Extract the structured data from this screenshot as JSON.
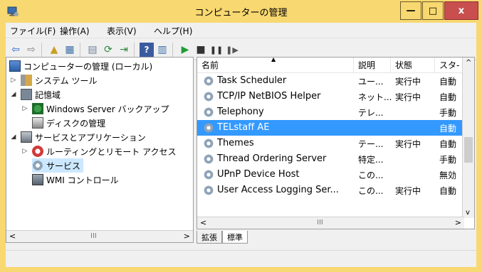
{
  "window": {
    "title": "コンピューターの管理",
    "min_label": "—",
    "max_label": "□",
    "close_label": "x"
  },
  "menu": [
    "ファイル(F)",
    "操作(A)",
    "表示(V)",
    "ヘルプ(H)"
  ],
  "tree": [
    {
      "label": "コンピューターの管理 (ローカル)",
      "icon": "computer-icon",
      "expander": ""
    },
    {
      "label": "システム ツール",
      "icon": "tools-icon",
      "expander": "▷"
    },
    {
      "label": "記憶域",
      "icon": "storage-icon",
      "expander": "◢"
    },
    {
      "label": "Windows Server バックアップ",
      "icon": "backup-icon",
      "expander": "▷"
    },
    {
      "label": "ディスクの管理",
      "icon": "disk-icon",
      "expander": ""
    },
    {
      "label": "サービスとアプリケーション",
      "icon": "services-apps-icon",
      "expander": "◢"
    },
    {
      "label": "ルーティングとリモート アクセス",
      "icon": "routing-icon",
      "expander": "▷"
    },
    {
      "label": "サービス",
      "icon": "gear-icon",
      "expander": ""
    },
    {
      "label": "WMI コントロール",
      "icon": "wmi-icon",
      "expander": ""
    }
  ],
  "columns": [
    "名前",
    "説明",
    "状態",
    "スタ-"
  ],
  "rows": [
    {
      "name": "Task Scheduler",
      "desc": "ユー...",
      "status": "実行中",
      "start": "自動"
    },
    {
      "name": "TCP/IP NetBIOS Helper",
      "desc": "ネット...",
      "status": "実行中",
      "start": "自動"
    },
    {
      "name": "Telephony",
      "desc": "テレ...",
      "status": "",
      "start": "手動"
    },
    {
      "name": "TELstaff AE",
      "desc": "",
      "status": "",
      "start": "自動",
      "selected": true
    },
    {
      "name": "Themes",
      "desc": "テー...",
      "status": "実行中",
      "start": "自動"
    },
    {
      "name": "Thread Ordering Server",
      "desc": "特定...",
      "status": "",
      "start": "手動"
    },
    {
      "name": "UPnP Device Host",
      "desc": "この...",
      "status": "",
      "start": "無効"
    },
    {
      "name": "User Access Logging Ser...",
      "desc": "この...",
      "status": "実行中",
      "start": "自動"
    }
  ],
  "scroll": {
    "left_arrow": "<",
    "right_arrow": ">",
    "up_arrow": "^",
    "down_arrow": "v",
    "thumb": "III"
  },
  "tabs": [
    "拡張",
    "標準"
  ],
  "colors": {
    "titlebar": "#f8d870",
    "selection": "#3399ff",
    "close": "#c94f4f"
  }
}
